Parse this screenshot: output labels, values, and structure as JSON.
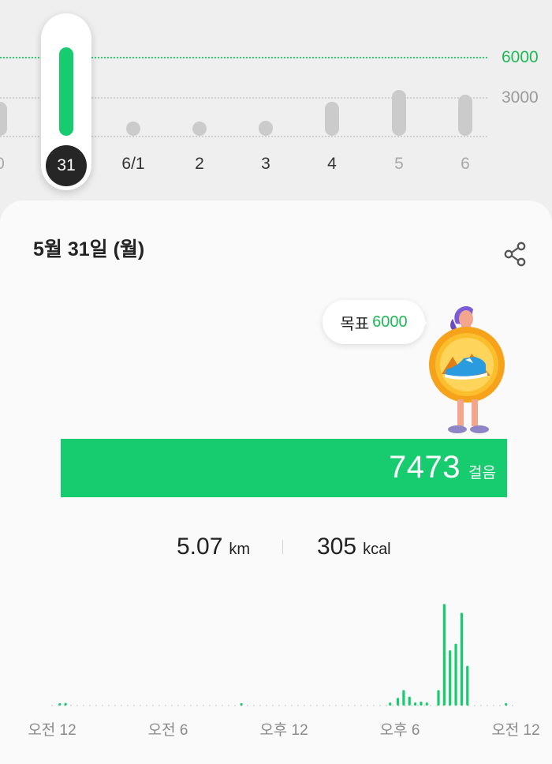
{
  "week_chart": {
    "goal_label": "6000",
    "mid_label": "3000",
    "days": [
      {
        "label": "0",
        "steps": 2900
      },
      {
        "label": "31",
        "steps": 7473
      },
      {
        "label": "6/1",
        "steps": 900
      },
      {
        "label": "2",
        "steps": 1200
      },
      {
        "label": "3",
        "steps": 1300
      },
      {
        "label": "4",
        "steps": 2900
      },
      {
        "label": "5",
        "steps": 3900
      },
      {
        "label": "6",
        "steps": 3500
      }
    ],
    "selected_label": "31"
  },
  "detail": {
    "date_title": "5월 31일 (월)",
    "goal_word": "목표",
    "goal_value": "6000",
    "steps_value": "7473",
    "steps_unit": "걸음",
    "distance_value": "5.07",
    "distance_unit": "km",
    "calories_value": "305",
    "calories_unit": "kcal"
  },
  "chart_data": {
    "type": "bar",
    "title": "",
    "xlabel": "",
    "ylabel": "",
    "x_tick_labels": [
      "오전 12",
      "오전 6",
      "오후 12",
      "오후 6",
      "오전 12"
    ],
    "x_range_hours": [
      0,
      24
    ],
    "series": [
      {
        "values": [
          {
            "hour": 0.4,
            "steps": 5
          },
          {
            "hour": 0.7,
            "steps": 12
          },
          {
            "hour": 9.8,
            "steps": 6
          },
          {
            "hour": 17.5,
            "steps": 14
          },
          {
            "hour": 17.9,
            "steps": 35
          },
          {
            "hour": 18.2,
            "steps": 70
          },
          {
            "hour": 18.5,
            "steps": 40
          },
          {
            "hour": 18.8,
            "steps": 14
          },
          {
            "hour": 19.1,
            "steps": 18
          },
          {
            "hour": 19.4,
            "steps": 14
          },
          {
            "hour": 20.0,
            "steps": 70
          },
          {
            "hour": 20.3,
            "steps": 460
          },
          {
            "hour": 20.6,
            "steps": 250
          },
          {
            "hour": 20.9,
            "steps": 280
          },
          {
            "hour": 21.2,
            "steps": 420
          },
          {
            "hour": 21.5,
            "steps": 180
          },
          {
            "hour": 23.5,
            "steps": 5
          }
        ]
      }
    ],
    "ylim": [
      0,
      500
    ]
  },
  "colors": {
    "accent": "#16cc6e",
    "goal_text": "#1db954",
    "bar_inactive": "#cbcbcb",
    "selected_badge": "#262626"
  },
  "icons": {
    "share": "share-icon"
  }
}
